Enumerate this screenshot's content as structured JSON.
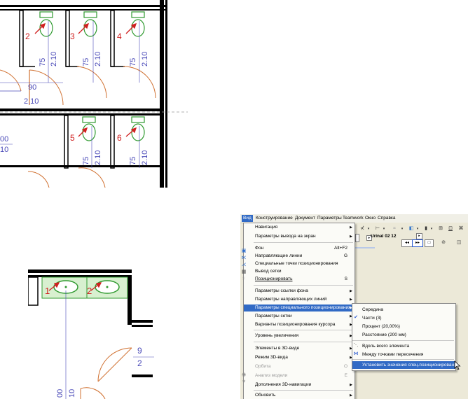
{
  "plan_top": {
    "stall_numbers": [
      "2",
      "3",
      "4",
      "5",
      "6"
    ],
    "stall_dims": [
      "75",
      "2.10"
    ],
    "door_dims": [
      "90",
      "2.10"
    ],
    "edge_dims": [
      "00",
      "10"
    ]
  },
  "plan_bottom": {
    "sink_numbers": [
      "1",
      "2"
    ],
    "door_dims": [
      "9",
      "2"
    ],
    "edge_dims": [
      "00",
      "10"
    ]
  },
  "menubar": {
    "items": [
      "Вид",
      "Конструирование",
      "Документ",
      "Параметры",
      "Teamwork",
      "Окно",
      "Справка"
    ]
  },
  "toolbar": {
    "object_name": "Urinal 02 12"
  },
  "menu": {
    "items": [
      {
        "label": "Навигация",
        "submenu": true
      },
      {
        "label": "Параметры вывода на экран",
        "submenu": true
      },
      {
        "label": "Фон",
        "shortcut": "Alt+F2"
      },
      {
        "label": "Направляющие линии",
        "shortcut": "G"
      },
      {
        "label": "Специальные точки позиционирования"
      },
      {
        "label": "Вывод сетки"
      },
      {
        "label": "Позиционировать",
        "shortcut": "S"
      },
      {
        "label": "Параметры ссылки фона",
        "submenu": true
      },
      {
        "label": "Параметры направляющих линий",
        "submenu": true
      },
      {
        "label": "Параметры специального позиционирования",
        "submenu": true
      },
      {
        "label": "Параметры сетки",
        "submenu": true
      },
      {
        "label": "Варианты позиционирования курсора",
        "submenu": true
      },
      {
        "label": "Уровень увеличения",
        "submenu": true
      },
      {
        "label": "Элементы в 3D-виде",
        "submenu": true
      },
      {
        "label": "Режим 3D-вида",
        "submenu": true
      },
      {
        "label": "Орбита",
        "shortcut": "O"
      },
      {
        "label": "Анализ модели",
        "shortcut": "E"
      },
      {
        "label": "Дополнения 3D-навигации",
        "submenu": true
      },
      {
        "label": "Обновить",
        "submenu": true
      }
    ]
  },
  "submenu": {
    "items": [
      {
        "label": "Середина"
      },
      {
        "label": "Части (3)",
        "checked": true
      },
      {
        "label": "Процент (20,00%)"
      },
      {
        "label": "Расстояние (200 мм)"
      },
      {
        "label": "Вдоль всего элемента"
      },
      {
        "label": "Между точками пересечения"
      },
      {
        "label": "Установить значения спец.позиционирования..."
      }
    ]
  },
  "colors": {
    "highlight": "#316ac5",
    "fixture_green": "#2f9a2f",
    "label_red": "#d02020",
    "door_orange": "#d07030",
    "dimension_blue": "#4a4ab8"
  }
}
